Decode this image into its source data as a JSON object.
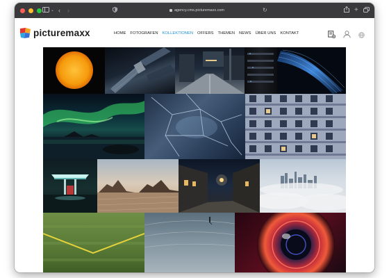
{
  "browser": {
    "url": "agency.cms.picturemaxx.com",
    "traffic_colors": [
      "#ff5f57",
      "#febc2e",
      "#28c840"
    ]
  },
  "site": {
    "logo_text": "picturemaxx",
    "brand_colors": [
      "#e3342f",
      "#f6a623",
      "#2ea8df",
      "#3a6fd8"
    ],
    "accent": "#1f8fd3"
  },
  "nav": {
    "items": [
      {
        "label": "HOME",
        "active": false
      },
      {
        "label": "FOTOGRAFEN",
        "active": false
      },
      {
        "label": "KOLLEKTIONEN",
        "active": true
      },
      {
        "label": "OFFERS",
        "active": false
      },
      {
        "label": "THEMEN",
        "active": false
      },
      {
        "label": "NEWS",
        "active": false
      },
      {
        "label": "ÜBER UNS",
        "active": false
      },
      {
        "label": "KONTAKT",
        "active": false
      }
    ]
  },
  "header_icons": [
    "lightbox-icon",
    "user-icon",
    "globe-icon"
  ],
  "gallery": {
    "images": [
      {
        "name": "sun-photo"
      },
      {
        "name": "satellite-photo"
      },
      {
        "name": "night-street-photo"
      },
      {
        "name": "server-rack-photo"
      },
      {
        "name": "fiber-optics-photo"
      },
      {
        "name": "aurora-photo"
      },
      {
        "name": "ice-texture-photo"
      },
      {
        "name": "building-facade-photo"
      },
      {
        "name": "gas-station-photo"
      },
      {
        "name": "desert-rocks-photo"
      },
      {
        "name": "night-alley-photo"
      },
      {
        "name": "city-fog-photo"
      },
      {
        "name": "sports-field-photo"
      },
      {
        "name": "skater-ramp-photo"
      },
      {
        "name": "camera-lens-photo"
      }
    ]
  }
}
